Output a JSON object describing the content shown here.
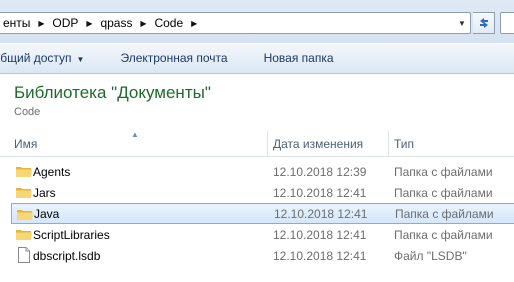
{
  "address_bar": {
    "crumbs": [
      "енты",
      "ODP",
      "qpass",
      "Code"
    ]
  },
  "toolbar": {
    "share_label": "ьбщий доступ",
    "email_label": "Электронная почта",
    "new_folder_label": "Новая папка"
  },
  "library": {
    "title": "Библиотека \"Документы\"",
    "subtitle": "Code"
  },
  "columns": {
    "name": "Имя",
    "date": "Дата изменения",
    "type": "Тип"
  },
  "files": [
    {
      "name": "Agents",
      "date": "12.10.2018 12:39",
      "type": "Папка с файлами",
      "icon": "folder-icon",
      "selected": false
    },
    {
      "name": "Jars",
      "date": "12.10.2018 12:41",
      "type": "Папка с файлами",
      "icon": "folder-icon",
      "selected": false
    },
    {
      "name": "Java",
      "date": "12.10.2018 12:41",
      "type": "Папка с файлами",
      "icon": "folder-icon",
      "selected": true
    },
    {
      "name": "ScriptLibraries",
      "date": "12.10.2018 12:41",
      "type": "Папка с файлами",
      "icon": "folder-icon",
      "selected": false
    },
    {
      "name": "dbscript.lsdb",
      "date": "12.10.2018 12:41",
      "type": "Файл \"LSDB\"",
      "icon": "file-icon",
      "selected": false
    }
  ],
  "colors": {
    "title_green": "#1e6b2c",
    "selection": "#d4e7fb",
    "selection_border": "#84acdd",
    "folder_yellow": "#f0c550"
  }
}
